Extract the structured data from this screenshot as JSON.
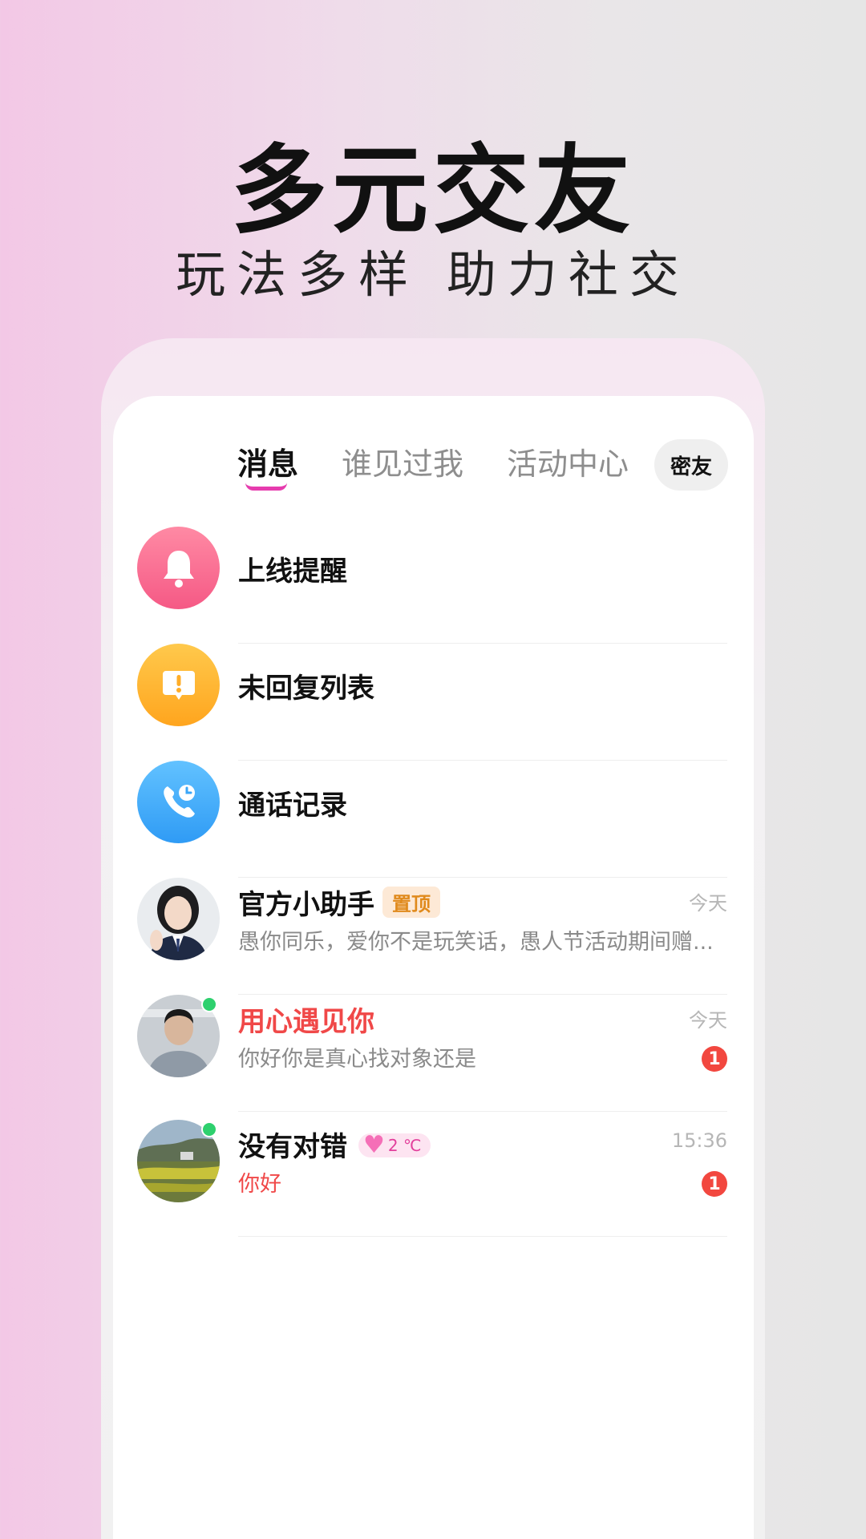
{
  "hero": {
    "title": "多元交友",
    "subtitle": "玩法多样 助力社交"
  },
  "tabs": [
    {
      "label": "消息",
      "active": true
    },
    {
      "label": "谁见过我",
      "active": false
    },
    {
      "label": "活动中心",
      "active": false
    },
    {
      "label": "密友",
      "active": false
    }
  ],
  "shortcuts": [
    {
      "label": "上线提醒",
      "icon": "bell-icon"
    },
    {
      "label": "未回复列表",
      "icon": "alert-icon"
    },
    {
      "label": "通话记录",
      "icon": "phone-clock-icon"
    }
  ],
  "chats": [
    {
      "name": "官方小助手",
      "badge": "置顶",
      "preview": "愚你同乐，爱你不是玩笑话，愚人节活动期间赠...",
      "time": "今天"
    },
    {
      "name": "用心遇见你",
      "preview": "你好你是真心找对象还是",
      "time": "今天",
      "unread": "1",
      "online": true
    },
    {
      "name": "没有对错",
      "intimacy": "2 ℃",
      "preview": "你好",
      "time": "15:36",
      "unread": "1",
      "online": true
    }
  ],
  "colors": {
    "accent_pink": "#e63cae",
    "unread_red": "#f2473f",
    "online_green": "#2ed06e",
    "pin_orange": "#e08a1c"
  }
}
